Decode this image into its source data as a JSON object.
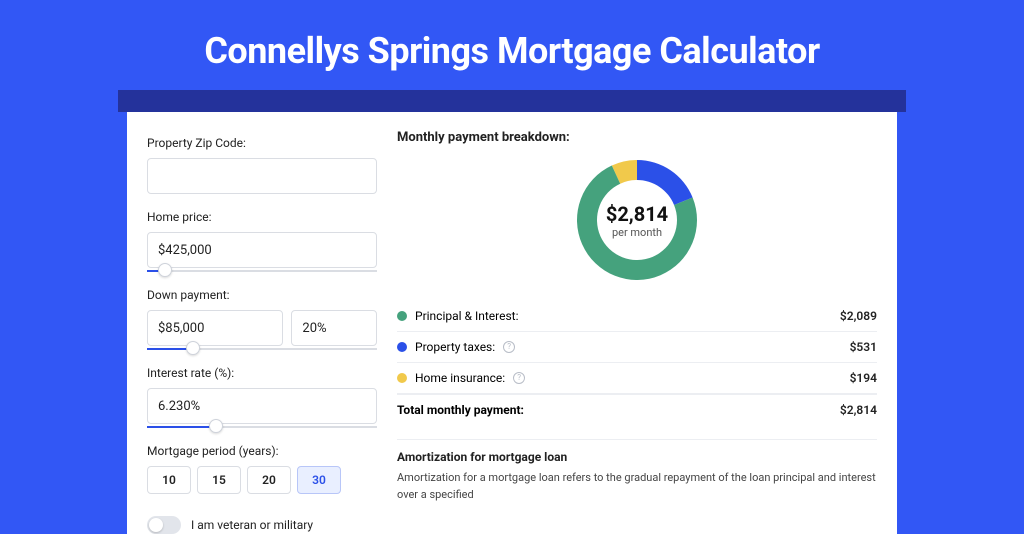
{
  "title": "Connellys Springs Mortgage Calculator",
  "form": {
    "zip_label": "Property Zip Code:",
    "zip_value": "",
    "home_price_label": "Home price:",
    "home_price_value": "$425,000",
    "home_price_slider_pct": 8,
    "down_payment_label": "Down payment:",
    "down_payment_amount": "$85,000",
    "down_payment_pct": "20%",
    "down_payment_slider_pct": 20,
    "interest_label": "Interest rate (%):",
    "interest_value": "6.230%",
    "interest_slider_pct": 30,
    "period_label": "Mortgage period (years):",
    "periods": [
      "10",
      "15",
      "20",
      "30"
    ],
    "period_selected": "30",
    "veteran_label": "I am veteran or military",
    "veteran_on": false
  },
  "breakdown": {
    "title": "Monthly payment breakdown:",
    "donut_amount": "$2,814",
    "donut_sub": "per month",
    "rows": [
      {
        "label": "Principal & Interest:",
        "value": "$2,089",
        "color": "#45a27d",
        "info": false
      },
      {
        "label": "Property taxes:",
        "value": "$531",
        "color": "#2b50e8",
        "info": true
      },
      {
        "label": "Home insurance:",
        "value": "$194",
        "color": "#f1c94b",
        "info": true
      }
    ],
    "total_label": "Total monthly payment:",
    "total_value": "$2,814"
  },
  "amortization": {
    "title": "Amortization for mortgage loan",
    "text": "Amortization for a mortgage loan refers to the gradual repayment of the loan principal and interest over a specified"
  },
  "chart_data": {
    "type": "pie",
    "title": "Monthly payment breakdown",
    "total_label": "$2,814 per month",
    "series": [
      {
        "name": "Principal & Interest",
        "value": 2089,
        "color": "#45a27d"
      },
      {
        "name": "Property taxes",
        "value": 531,
        "color": "#2b50e8"
      },
      {
        "name": "Home insurance",
        "value": 194,
        "color": "#f1c94b"
      }
    ]
  }
}
